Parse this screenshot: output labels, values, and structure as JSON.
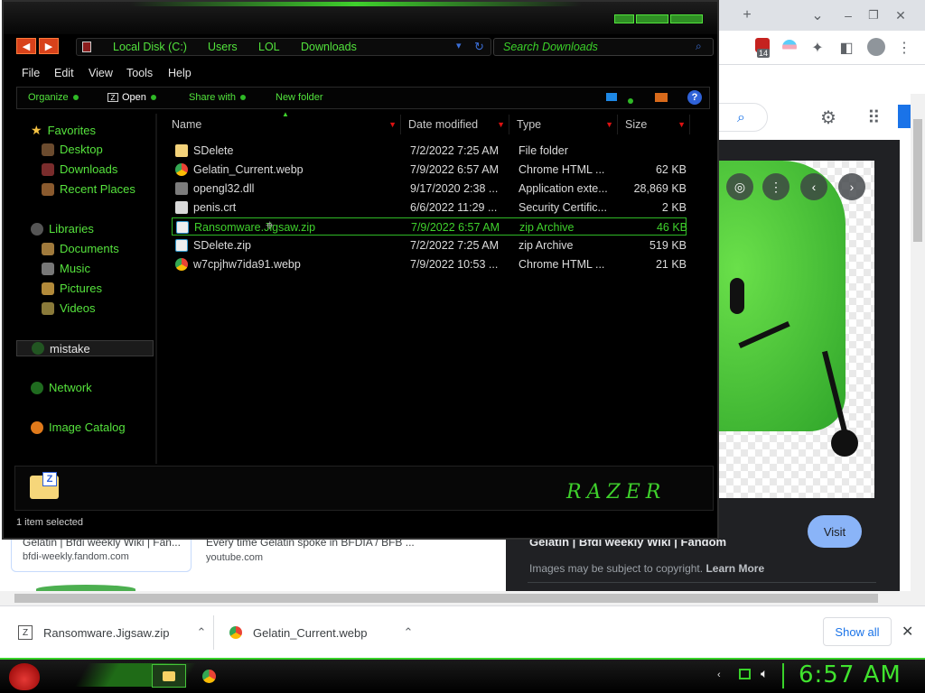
{
  "browser": {
    "tabbar": {
      "new_tab_label": "+",
      "menu_label": "⌄"
    },
    "toolbar": {
      "extensions_badge": "14"
    },
    "images": {
      "visit_label": "Visit",
      "result_title": "Gelatin | Bfdi weekly Wiki | Fandom",
      "copyright_note": "Images may be subject to copyright.",
      "learn_more": "Learn More"
    },
    "results": [
      {
        "title": "Gelatin | Bfdi weekly Wiki | Fan...",
        "source": "bfdi-weekly.fandom.com"
      },
      {
        "title": "Every time Gelatin spoke in BFDIA / BFB ...",
        "source": "youtube.com"
      }
    ],
    "downloads": {
      "items": [
        {
          "name": "Ransomware.Jigsaw.zip"
        },
        {
          "name": "Gelatin_Current.webp"
        }
      ],
      "show_all_label": "Show all"
    }
  },
  "explorer": {
    "breadcrumb": [
      "Local Disk (C:)",
      "Users",
      "LOL",
      "Downloads"
    ],
    "search_placeholder": "Search Downloads",
    "menu": [
      "File",
      "Edit",
      "View",
      "Tools",
      "Help"
    ],
    "commands": {
      "organize": "Organize",
      "open": "Open",
      "share": "Share with",
      "new_folder": "New folder"
    },
    "nav": {
      "favorites": "Favorites",
      "desktop": "Desktop",
      "downloads": "Downloads",
      "recent": "Recent Places",
      "libraries": "Libraries",
      "documents": "Documents",
      "music": "Music",
      "pictures": "Pictures",
      "videos": "Videos",
      "homegroup": "mistake",
      "network": "Network",
      "catalog": "Image Catalog"
    },
    "columns": {
      "name": "Name",
      "date": "Date modified",
      "type": "Type",
      "size": "Size"
    },
    "files": [
      {
        "name": "SDelete",
        "date": "7/2/2022 7:25 AM",
        "type": "File folder",
        "size": "",
        "icon": "folder-icon"
      },
      {
        "name": "Gelatin_Current.webp",
        "date": "7/9/2022 6:57 AM",
        "type": "Chrome HTML ...",
        "size": "62 KB",
        "icon": "chrome-file-icon"
      },
      {
        "name": "opengl32.dll",
        "date": "9/17/2020 2:38 ...",
        "type": "Application exte...",
        "size": "28,869 KB",
        "icon": "dll-icon"
      },
      {
        "name": "penis.crt",
        "date": "6/6/2022 11:29 ...",
        "type": "Security Certific...",
        "size": "2 KB",
        "icon": "certificate-icon"
      },
      {
        "name": "Ransomware.Jigsaw.zip",
        "date": "7/9/2022 6:57 AM",
        "type": "zip Archive",
        "size": "46 KB",
        "icon": "zip-icon",
        "selected": true
      },
      {
        "name": "SDelete.zip",
        "date": "7/2/2022 7:25 AM",
        "type": "zip Archive",
        "size": "519 KB",
        "icon": "zip-icon"
      },
      {
        "name": "w7cpjhw7ida91.webp",
        "date": "7/9/2022 10:53 ...",
        "type": "Chrome HTML ...",
        "size": "21 KB",
        "icon": "chrome-file-icon"
      }
    ],
    "brand": "RAZER",
    "status": "1 item selected"
  },
  "taskbar": {
    "clock": "6:57 AM"
  },
  "colors": {
    "accent_green": "#3fd12c",
    "explorer_bg": "#000000",
    "chrome_blue": "#1a73e8",
    "visit_button": "#8ab4f8"
  }
}
